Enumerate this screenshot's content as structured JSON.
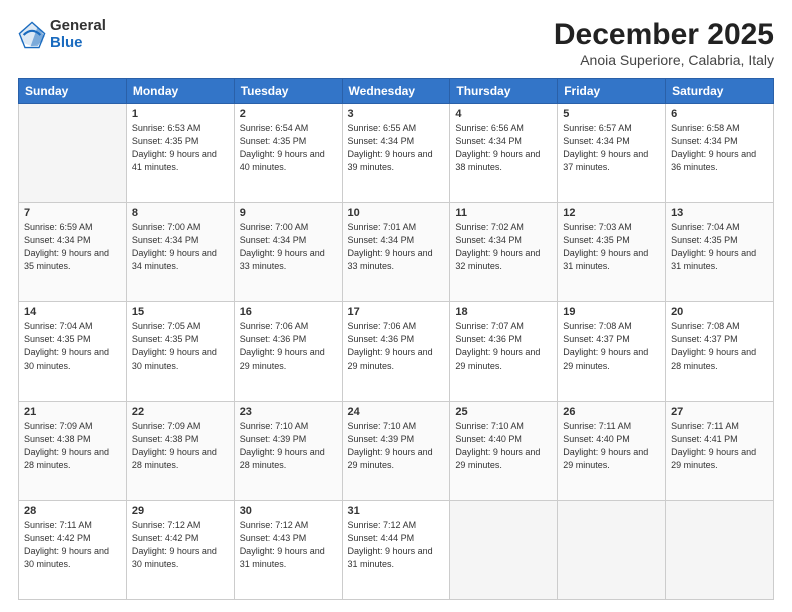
{
  "logo": {
    "general": "General",
    "blue": "Blue"
  },
  "title": "December 2025",
  "subtitle": "Anoia Superiore, Calabria, Italy",
  "days_header": [
    "Sunday",
    "Monday",
    "Tuesday",
    "Wednesday",
    "Thursday",
    "Friday",
    "Saturday"
  ],
  "weeks": [
    [
      {
        "day": "",
        "sunrise": "",
        "sunset": "",
        "daylight": "",
        "empty": true
      },
      {
        "day": "1",
        "sunrise": "Sunrise: 6:53 AM",
        "sunset": "Sunset: 4:35 PM",
        "daylight": "Daylight: 9 hours and 41 minutes."
      },
      {
        "day": "2",
        "sunrise": "Sunrise: 6:54 AM",
        "sunset": "Sunset: 4:35 PM",
        "daylight": "Daylight: 9 hours and 40 minutes."
      },
      {
        "day": "3",
        "sunrise": "Sunrise: 6:55 AM",
        "sunset": "Sunset: 4:34 PM",
        "daylight": "Daylight: 9 hours and 39 minutes."
      },
      {
        "day": "4",
        "sunrise": "Sunrise: 6:56 AM",
        "sunset": "Sunset: 4:34 PM",
        "daylight": "Daylight: 9 hours and 38 minutes."
      },
      {
        "day": "5",
        "sunrise": "Sunrise: 6:57 AM",
        "sunset": "Sunset: 4:34 PM",
        "daylight": "Daylight: 9 hours and 37 minutes."
      },
      {
        "day": "6",
        "sunrise": "Sunrise: 6:58 AM",
        "sunset": "Sunset: 4:34 PM",
        "daylight": "Daylight: 9 hours and 36 minutes."
      }
    ],
    [
      {
        "day": "7",
        "sunrise": "Sunrise: 6:59 AM",
        "sunset": "Sunset: 4:34 PM",
        "daylight": "Daylight: 9 hours and 35 minutes."
      },
      {
        "day": "8",
        "sunrise": "Sunrise: 7:00 AM",
        "sunset": "Sunset: 4:34 PM",
        "daylight": "Daylight: 9 hours and 34 minutes."
      },
      {
        "day": "9",
        "sunrise": "Sunrise: 7:00 AM",
        "sunset": "Sunset: 4:34 PM",
        "daylight": "Daylight: 9 hours and 33 minutes."
      },
      {
        "day": "10",
        "sunrise": "Sunrise: 7:01 AM",
        "sunset": "Sunset: 4:34 PM",
        "daylight": "Daylight: 9 hours and 33 minutes."
      },
      {
        "day": "11",
        "sunrise": "Sunrise: 7:02 AM",
        "sunset": "Sunset: 4:34 PM",
        "daylight": "Daylight: 9 hours and 32 minutes."
      },
      {
        "day": "12",
        "sunrise": "Sunrise: 7:03 AM",
        "sunset": "Sunset: 4:35 PM",
        "daylight": "Daylight: 9 hours and 31 minutes."
      },
      {
        "day": "13",
        "sunrise": "Sunrise: 7:04 AM",
        "sunset": "Sunset: 4:35 PM",
        "daylight": "Daylight: 9 hours and 31 minutes."
      }
    ],
    [
      {
        "day": "14",
        "sunrise": "Sunrise: 7:04 AM",
        "sunset": "Sunset: 4:35 PM",
        "daylight": "Daylight: 9 hours and 30 minutes."
      },
      {
        "day": "15",
        "sunrise": "Sunrise: 7:05 AM",
        "sunset": "Sunset: 4:35 PM",
        "daylight": "Daylight: 9 hours and 30 minutes."
      },
      {
        "day": "16",
        "sunrise": "Sunrise: 7:06 AM",
        "sunset": "Sunset: 4:36 PM",
        "daylight": "Daylight: 9 hours and 29 minutes."
      },
      {
        "day": "17",
        "sunrise": "Sunrise: 7:06 AM",
        "sunset": "Sunset: 4:36 PM",
        "daylight": "Daylight: 9 hours and 29 minutes."
      },
      {
        "day": "18",
        "sunrise": "Sunrise: 7:07 AM",
        "sunset": "Sunset: 4:36 PM",
        "daylight": "Daylight: 9 hours and 29 minutes."
      },
      {
        "day": "19",
        "sunrise": "Sunrise: 7:08 AM",
        "sunset": "Sunset: 4:37 PM",
        "daylight": "Daylight: 9 hours and 29 minutes."
      },
      {
        "day": "20",
        "sunrise": "Sunrise: 7:08 AM",
        "sunset": "Sunset: 4:37 PM",
        "daylight": "Daylight: 9 hours and 28 minutes."
      }
    ],
    [
      {
        "day": "21",
        "sunrise": "Sunrise: 7:09 AM",
        "sunset": "Sunset: 4:38 PM",
        "daylight": "Daylight: 9 hours and 28 minutes."
      },
      {
        "day": "22",
        "sunrise": "Sunrise: 7:09 AM",
        "sunset": "Sunset: 4:38 PM",
        "daylight": "Daylight: 9 hours and 28 minutes."
      },
      {
        "day": "23",
        "sunrise": "Sunrise: 7:10 AM",
        "sunset": "Sunset: 4:39 PM",
        "daylight": "Daylight: 9 hours and 28 minutes."
      },
      {
        "day": "24",
        "sunrise": "Sunrise: 7:10 AM",
        "sunset": "Sunset: 4:39 PM",
        "daylight": "Daylight: 9 hours and 29 minutes."
      },
      {
        "day": "25",
        "sunrise": "Sunrise: 7:10 AM",
        "sunset": "Sunset: 4:40 PM",
        "daylight": "Daylight: 9 hours and 29 minutes."
      },
      {
        "day": "26",
        "sunrise": "Sunrise: 7:11 AM",
        "sunset": "Sunset: 4:40 PM",
        "daylight": "Daylight: 9 hours and 29 minutes."
      },
      {
        "day": "27",
        "sunrise": "Sunrise: 7:11 AM",
        "sunset": "Sunset: 4:41 PM",
        "daylight": "Daylight: 9 hours and 29 minutes."
      }
    ],
    [
      {
        "day": "28",
        "sunrise": "Sunrise: 7:11 AM",
        "sunset": "Sunset: 4:42 PM",
        "daylight": "Daylight: 9 hours and 30 minutes."
      },
      {
        "day": "29",
        "sunrise": "Sunrise: 7:12 AM",
        "sunset": "Sunset: 4:42 PM",
        "daylight": "Daylight: 9 hours and 30 minutes."
      },
      {
        "day": "30",
        "sunrise": "Sunrise: 7:12 AM",
        "sunset": "Sunset: 4:43 PM",
        "daylight": "Daylight: 9 hours and 31 minutes."
      },
      {
        "day": "31",
        "sunrise": "Sunrise: 7:12 AM",
        "sunset": "Sunset: 4:44 PM",
        "daylight": "Daylight: 9 hours and 31 minutes."
      },
      {
        "day": "",
        "sunrise": "",
        "sunset": "",
        "daylight": "",
        "empty": true
      },
      {
        "day": "",
        "sunrise": "",
        "sunset": "",
        "daylight": "",
        "empty": true
      },
      {
        "day": "",
        "sunrise": "",
        "sunset": "",
        "daylight": "",
        "empty": true
      }
    ]
  ]
}
